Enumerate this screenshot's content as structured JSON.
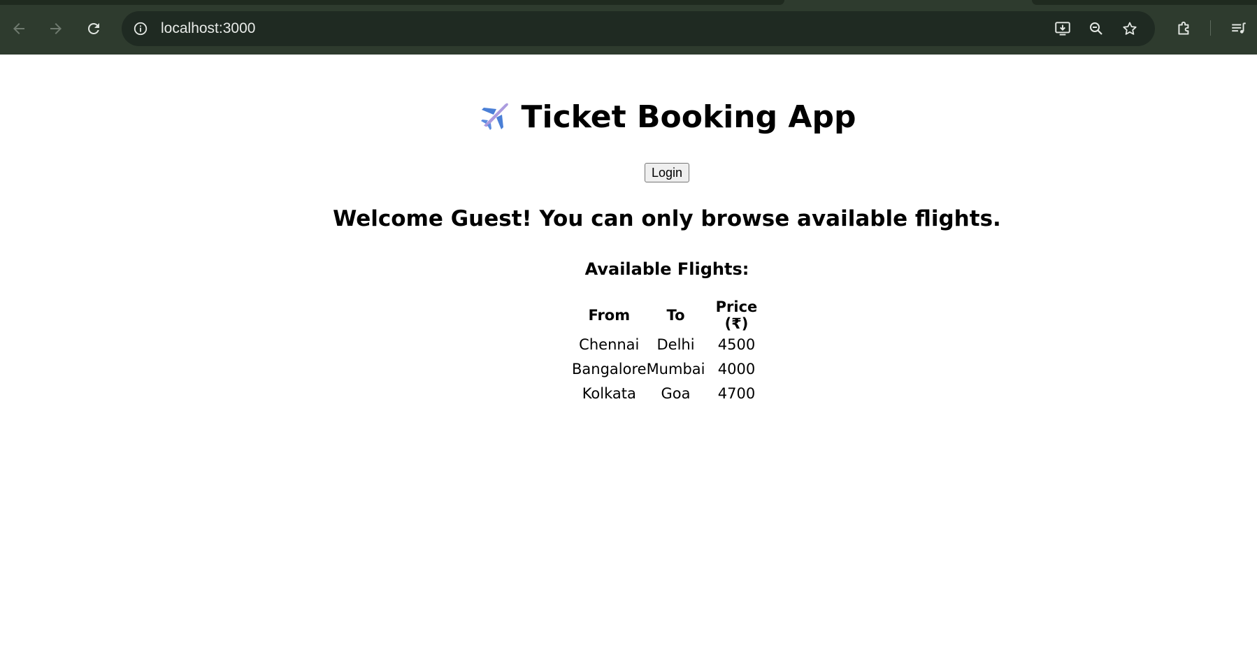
{
  "browser": {
    "url": "localhost:3000",
    "icons": {
      "back": "back-arrow-icon",
      "forward": "forward-arrow-icon",
      "reload": "reload-icon",
      "site_info": "info-icon",
      "install": "install-app-icon",
      "zoom": "zoom-out-icon",
      "bookmark": "star-icon",
      "extensions": "puzzle-icon",
      "media": "media-controls-icon"
    },
    "colors": {
      "toolbar": "#2e3b2e",
      "omnibox": "#1f2a22"
    }
  },
  "app": {
    "title": "Ticket Booking App",
    "title_icon": "airplane-icon",
    "login_label": "Login",
    "welcome_message": "Welcome Guest! You can only browse available flights.",
    "flights_heading": "Available Flights:"
  },
  "flights": {
    "columns": [
      "From",
      "To",
      "Price (₹)"
    ],
    "rows": [
      {
        "from": "Chennai",
        "to": "Delhi",
        "price": "4500"
      },
      {
        "from": "Bangalore",
        "to": "Mumbai",
        "price": "4000"
      },
      {
        "from": "Kolkata",
        "to": "Goa",
        "price": "4700"
      }
    ]
  }
}
